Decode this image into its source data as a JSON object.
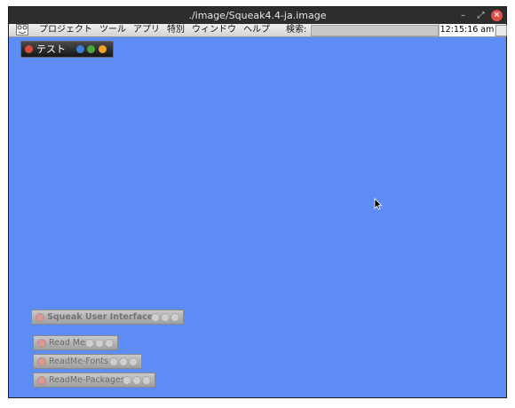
{
  "window": {
    "title": "./image/Squeak4.4-ja.image",
    "controls": {
      "minimize": "–",
      "maximize": "⤢",
      "close": "×"
    }
  },
  "menubar": {
    "items": [
      "プロジェクト",
      "ツール",
      "アプリ",
      "特別",
      "ウィンドウ",
      "ヘルプ"
    ],
    "search_label": "検索:",
    "search_value": "",
    "clock": "12:15:16 am"
  },
  "desktop": {
    "background": "#5d8cf5",
    "test_window": {
      "label": "テスト"
    },
    "collapsed_windows": [
      {
        "label": "Squeak User Interface"
      },
      {
        "label": "Read Me"
      },
      {
        "label": "ReadMe-Fonts"
      },
      {
        "label": "ReadMe-Packages"
      }
    ]
  }
}
